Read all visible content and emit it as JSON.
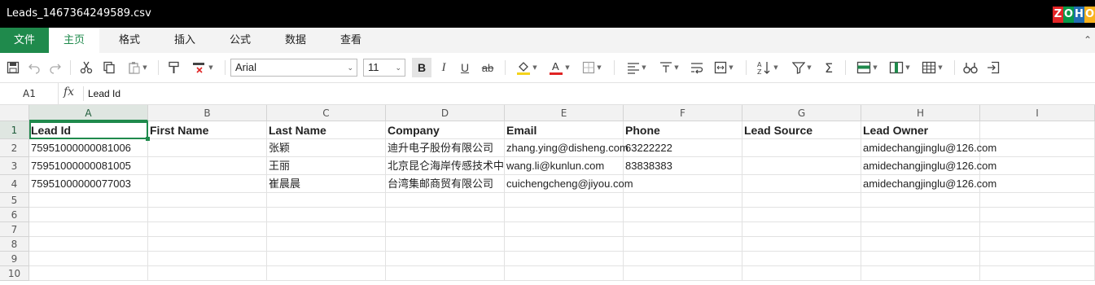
{
  "window": {
    "title": "Leads_1467364249589.csv",
    "logo_letters": [
      "Z",
      "O",
      "H",
      "O"
    ],
    "logo_colors": [
      "#e42527",
      "#089949",
      "#226db4",
      "#f9b21d"
    ]
  },
  "menu": {
    "items": [
      "文件",
      "主页",
      "格式",
      "插入",
      "公式",
      "数据",
      "查看"
    ],
    "active": "主页",
    "collapse_icon": "chevron-up-icon"
  },
  "toolbar": {
    "font_name": "Arial",
    "font_size": "11",
    "bold_label": "B",
    "italic_label": "I",
    "underline_label": "U",
    "strike_label": "ab",
    "accent_color": "#1f8a4c",
    "fill_color": "#f4d31b",
    "text_color": "#e02424"
  },
  "formula_bar": {
    "cell_ref": "A1",
    "fx_label": "fx",
    "content": "Lead Id"
  },
  "sheet": {
    "columns": [
      "A",
      "B",
      "C",
      "D",
      "E",
      "F",
      "G",
      "H",
      "I"
    ],
    "selected_column": "A",
    "row_numbers": [
      "1",
      "2",
      "3",
      "4",
      "5",
      "6",
      "7",
      "8",
      "9",
      "10"
    ],
    "rows": [
      [
        "Lead Id",
        "First Name",
        "Last Name",
        "Company",
        "Email",
        "Phone",
        "Lead Source",
        "Lead Owner",
        ""
      ],
      [
        "75951000000081006",
        "",
        "张颖",
        "迪升电子股份有限公司",
        "zhang.ying@disheng.com",
        "63222222",
        "",
        "amidechangjinglu@126.com",
        ""
      ],
      [
        "75951000000081005",
        "",
        "王丽",
        "北京昆仑海岸传感技术中",
        "wang.li@kunlun.com",
        "83838383",
        "",
        "amidechangjinglu@126.com",
        ""
      ],
      [
        "75951000000077003",
        "",
        "崔晨晨",
        "台湾集邮商贸有限公司",
        "cuichengcheng@jiyou.com",
        "",
        "",
        "amidechangjinglu@126.com",
        ""
      ],
      [
        "",
        "",
        "",
        "",
        "",
        "",
        "",
        "",
        ""
      ],
      [
        "",
        "",
        "",
        "",
        "",
        "",
        "",
        "",
        ""
      ],
      [
        "",
        "",
        "",
        "",
        "",
        "",
        "",
        "",
        ""
      ],
      [
        "",
        "",
        "",
        "",
        "",
        "",
        "",
        "",
        ""
      ],
      [
        "",
        "",
        "",
        "",
        "",
        "",
        "",
        "",
        ""
      ],
      [
        "",
        "",
        "",
        "",
        "",
        "",
        "",
        "",
        ""
      ]
    ]
  }
}
